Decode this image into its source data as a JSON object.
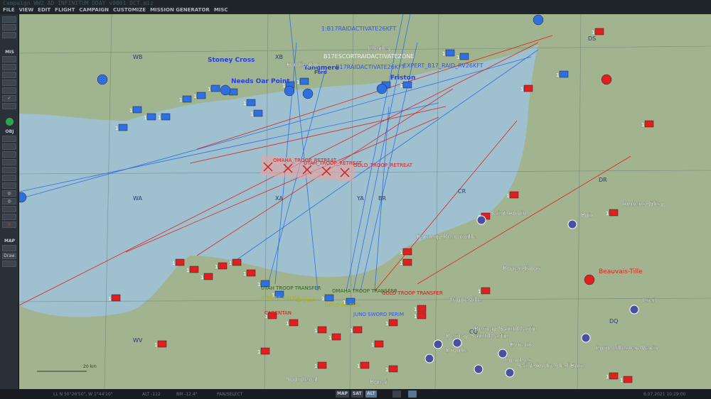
{
  "window": {
    "title": "Campaign WW2 AD INFINITUM DDAY v0001 DCT.miz"
  },
  "menu": [
    "FILE",
    "VIEW",
    "EDIT",
    "FLIGHT",
    "CAMPAIGN",
    "CUSTOMIZE",
    "MISSION GENERATOR",
    "MISC"
  ],
  "toolbar": {
    "mis_label": "MIS",
    "obj_label": "OBJ",
    "map_label": "MAP",
    "draw_label": "Draw"
  },
  "map": {
    "grid_labels": [
      "WB",
      "XB",
      "DS",
      "WA",
      "XA",
      "YA",
      "BR",
      "CR",
      "DR",
      "WV",
      "CQ",
      "DQ"
    ],
    "places_blue": [
      "Stoney Cross",
      "Needs Oar Point",
      "Tangmere",
      "Ford",
      "Friston"
    ],
    "places_white": [
      "Chailey",
      "Funtington",
      "Saint-Aubin",
      "Amiens-Glisy",
      "Fecamp-Benouville",
      "Rouen-Boos",
      "Triqueville",
      "Creil",
      "Bernay Saint Martin",
      "Bernay Saint Martin",
      "Evreux",
      "Broglie",
      "Cormeilles-en-Vexin",
      "Conches",
      "Saint-Andre-de-l'Eure",
      "Sourdeval",
      "Ronai",
      "Poix",
      "Beauvais-Tille"
    ],
    "red_place": "Beauvais-Tille",
    "routes_blue": [
      "1:B17RAIDACTIVATE26KFT",
      "B17RAIDACTIVATE26KFT",
      "EXPERT_B17_RAID_RV26KFT"
    ],
    "zone_label": "B17ESCORTRAIDACTIVATEZONE",
    "routes_red": [
      "OMAHA_TROOP_RETREAT",
      "UTAH_TROOP_RETREAT",
      "GOLD_TROOP_RETREAT"
    ],
    "beach_labels": [
      "UTAH TROOP TRANSFER",
      "OMAHA TROOP TRANSFER",
      "GOLD TROOP TRANSFER",
      "STMERE EGLISE",
      "CARENTAN",
      "GOLD INLAND",
      "OMAHA",
      "JUNO SWORD PERIM"
    ],
    "unit_count": "1",
    "scale": "20 km"
  },
  "status": {
    "coords": "LL N 50°26'50\", W 1°44'10\"",
    "alt": "ALT -112",
    "bm": "BM -12.4°",
    "mode": "PAN/SELECT",
    "map_btn": "MAP",
    "sat_btn": "SAT",
    "alt_btn": "ALT",
    "datetime": "6.07.2021 10:29:00"
  },
  "colors": {
    "blue": "#2f6fe0",
    "red": "#e02020",
    "land": "#9fb48f",
    "sea": "#9ec0cf"
  }
}
